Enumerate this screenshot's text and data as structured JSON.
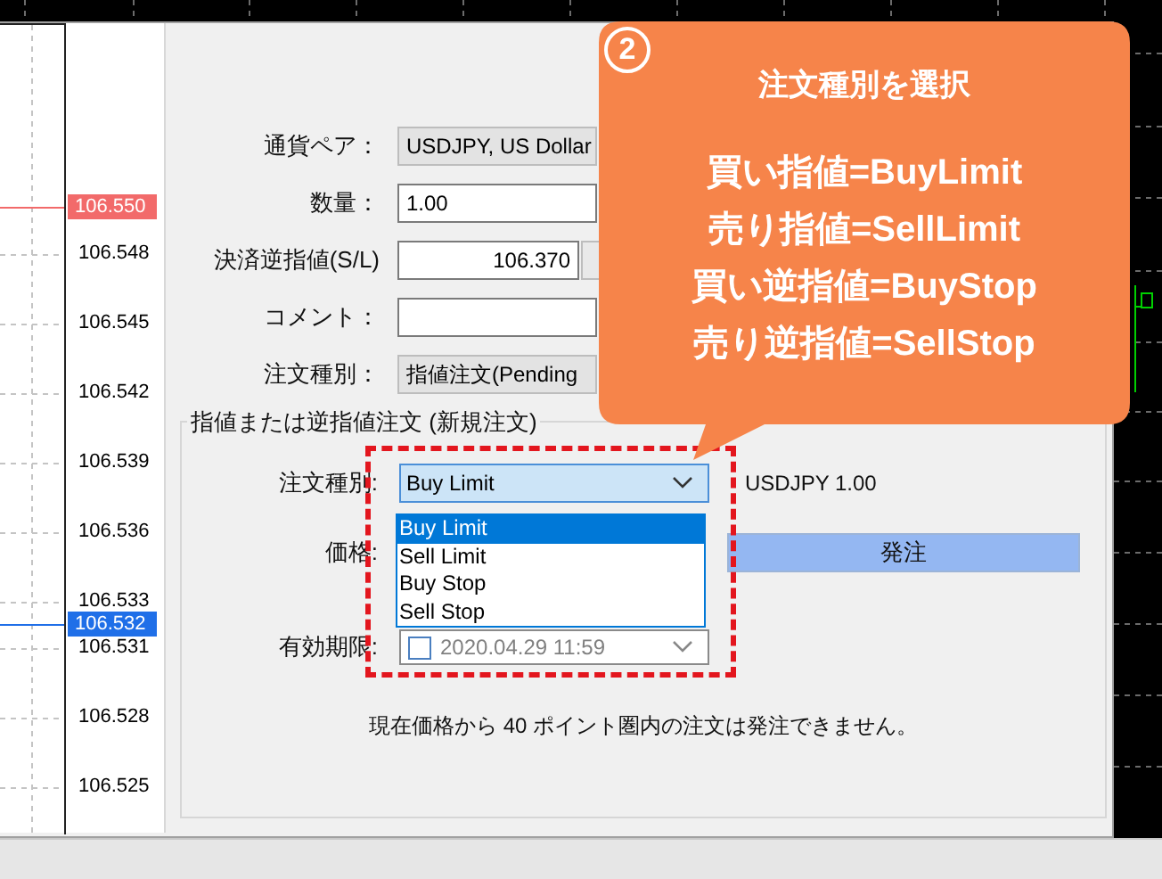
{
  "chart": {
    "price_labels": [
      {
        "text": "106.550",
        "kind": "ask"
      },
      {
        "text": "106.548",
        "kind": "tick"
      },
      {
        "text": "106.545",
        "kind": "tick"
      },
      {
        "text": "106.542",
        "kind": "tick"
      },
      {
        "text": "106.539",
        "kind": "tick"
      },
      {
        "text": "106.536",
        "kind": "tick"
      },
      {
        "text": "106.533",
        "kind": "tick"
      },
      {
        "text": "106.532",
        "kind": "bid"
      },
      {
        "text": "106.531",
        "kind": "tick"
      },
      {
        "text": "106.528",
        "kind": "tick"
      },
      {
        "text": "106.525",
        "kind": "tick"
      }
    ]
  },
  "order_form": {
    "fields": [
      {
        "label": "通貨ペア：",
        "value": "USDJPY, US Dollar",
        "kind": "combo",
        "disabled": true
      },
      {
        "label": "数量：",
        "value": "1.00",
        "kind": "combo",
        "disabled": false
      },
      {
        "label": "決済逆指値(S/L)",
        "value": "106.370",
        "kind": "spin",
        "disabled": false
      },
      {
        "label": "コメント：",
        "kind": "text",
        "disabled": false
      },
      {
        "label": "注文種別：",
        "value": "指値注文(Pending",
        "kind": "combo",
        "disabled": true
      }
    ]
  },
  "pending_group": {
    "title": "指値または逆指値注文 (新規注文)",
    "order_type": {
      "label": "注文種別:",
      "value": "Buy Limit",
      "options": [
        {
          "label": "Buy Limit",
          "selected": true
        },
        {
          "label": "Sell Limit",
          "selected": false
        },
        {
          "label": "Buy Stop",
          "selected": false
        },
        {
          "label": "Sell Stop",
          "selected": false
        }
      ]
    },
    "symbol_volume": "USDJPY 1.00",
    "price": {
      "label": "価格:"
    },
    "submit_button": "発注",
    "expiry": {
      "label": "有効期限:",
      "checked": false,
      "value": "2020.04.29 11:59"
    },
    "note": "現在価格から 40 ポイント圏内の注文は発注できません。"
  },
  "callout": {
    "number": "2",
    "title": "注文種別を選択",
    "lines": [
      "買い指値=BuyLimit",
      "売り指値=SellLimit",
      "買い逆指値=BuyStop",
      "売り逆指値=SellStop"
    ]
  }
}
